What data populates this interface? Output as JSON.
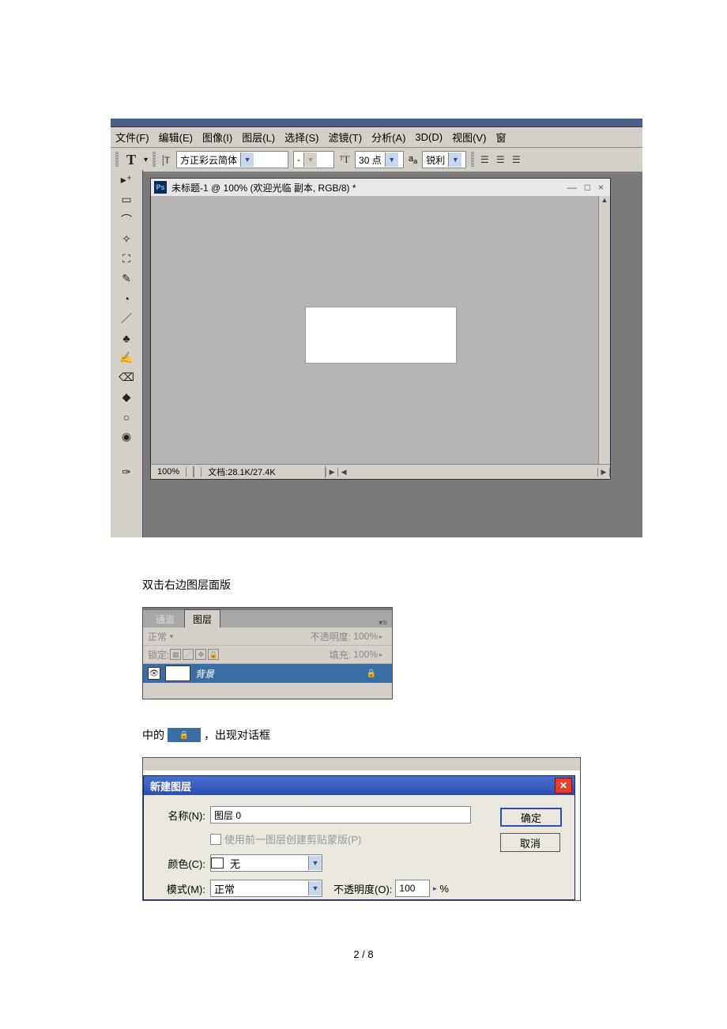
{
  "menu": {
    "file": "文件(F)",
    "edit": "编辑(E)",
    "image": "图像(I)",
    "layer": "图层(L)",
    "select": "选择(S)",
    "filter": "滤镜(T)",
    "analysis": "分析(A)",
    "threeD": "3D(D)",
    "view": "视图(V)",
    "win": "窗"
  },
  "options": {
    "font": "方正彩云简体",
    "fontSize": "30 点",
    "aa": "锐利",
    "orient": "⸽T"
  },
  "doc": {
    "title": "未标题-1 @ 100% (欢迎光临 副本, RGB/8) *",
    "zoom": "100%",
    "docsize": "文档:28.1K/27.4K"
  },
  "caption1": "双击右边图层面版",
  "panel": {
    "tabChannel": "通道",
    "tabLayer": "图层",
    "blend": "正常",
    "opacityLabel": "不透明度:",
    "opacityVal": "100%",
    "lockLabel": "锁定:",
    "fillLabel": "填充:",
    "fillVal": "100%",
    "layerName": "背景"
  },
  "sentence2": {
    "p1": "中的",
    "p2": "，出现对话框"
  },
  "dlg": {
    "title": "新建图层",
    "nameLbl": "名称(N):",
    "nameVal": "图层 0",
    "clipMask": "使用前一图层创建剪贴蒙版(P)",
    "colorLbl": "颜色(C):",
    "colorVal": "无",
    "modeLbl": "模式(M):",
    "modeVal": "正常",
    "opLbl": "不透明度(O):",
    "opVal": "100",
    "percent": "%",
    "ok": "确定",
    "cancel": "取消"
  },
  "footer": "2 / 8"
}
